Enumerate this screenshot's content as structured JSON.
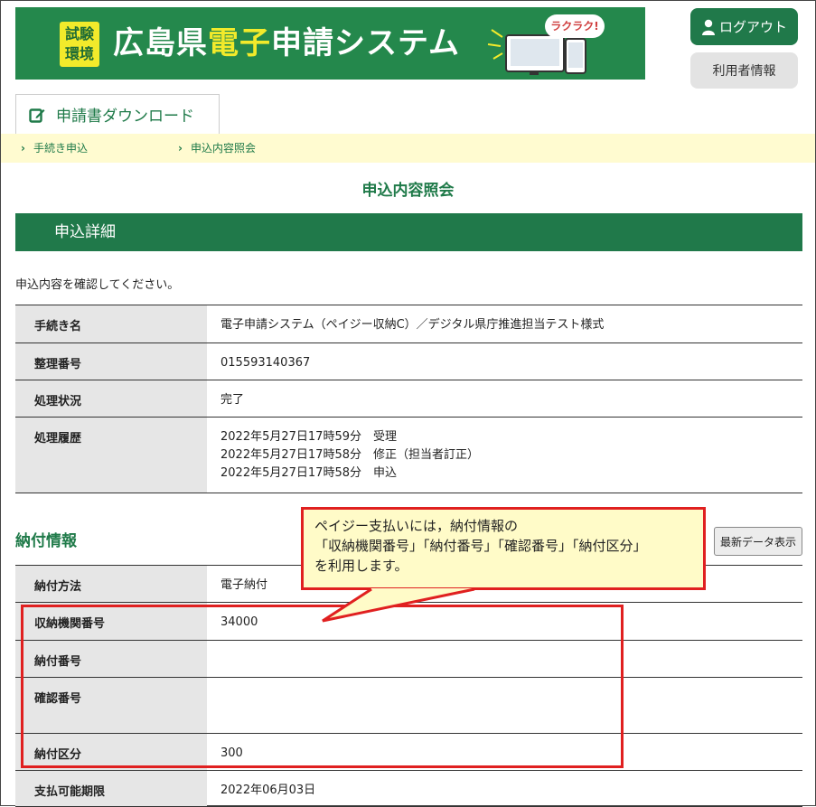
{
  "banner": {
    "badge_line1": "試験",
    "badge_line2": "環境",
    "title_part1": "広島県",
    "title_part2": "電子",
    "title_part3": "申",
    "title_part4": "請システム",
    "bubble": "ラクラク!",
    "brand_color": "#24884c",
    "accent_color": "#f2ea2b"
  },
  "header": {
    "logout_label": "ログアウト",
    "userinfo_label": "利用者情報"
  },
  "download_tab": {
    "label": "申請書ダウンロード"
  },
  "breadcrumb": {
    "items": [
      {
        "label": "手続き申込"
      },
      {
        "label": "申込内容照会"
      }
    ]
  },
  "page_title": "申込内容照会",
  "section": {
    "title": "申込詳細",
    "intro": "申込内容を確認してください。"
  },
  "detail_rows": [
    {
      "label": "手続き名",
      "value": "電子申請システム（ペイジー収納C）／デジタル県庁推進担当テスト様式"
    },
    {
      "label": "整理番号",
      "value": "015593140367"
    },
    {
      "label": "処理状況",
      "value": "完了"
    },
    {
      "label": "処理履歴",
      "lines": [
        "2022年5月27日17時59分　受理",
        "2022年5月27日17時58分　修正（担当者訂正）",
        "2022年5月27日17時58分　申込"
      ]
    }
  ],
  "payment": {
    "title": "納付情報",
    "refresh_label": "最新データ表示",
    "rows": [
      {
        "label": "納付方法",
        "value": "電子納付"
      },
      {
        "label": "収納機関番号",
        "value": "34000"
      },
      {
        "label": "納付番号",
        "value": ""
      },
      {
        "label": "確認番号",
        "value": ""
      },
      {
        "label": "納付区分",
        "value": "300"
      },
      {
        "label": "支払可能期限",
        "value": "2022年06月03日"
      }
    ]
  },
  "callout": {
    "line1": "ペイジー支払いには，納付情報の",
    "line2": "「収納機関番号」「納付番号」「確認番号」「納付区分」",
    "line3": "を利用します。",
    "border_color": "#e02020"
  }
}
